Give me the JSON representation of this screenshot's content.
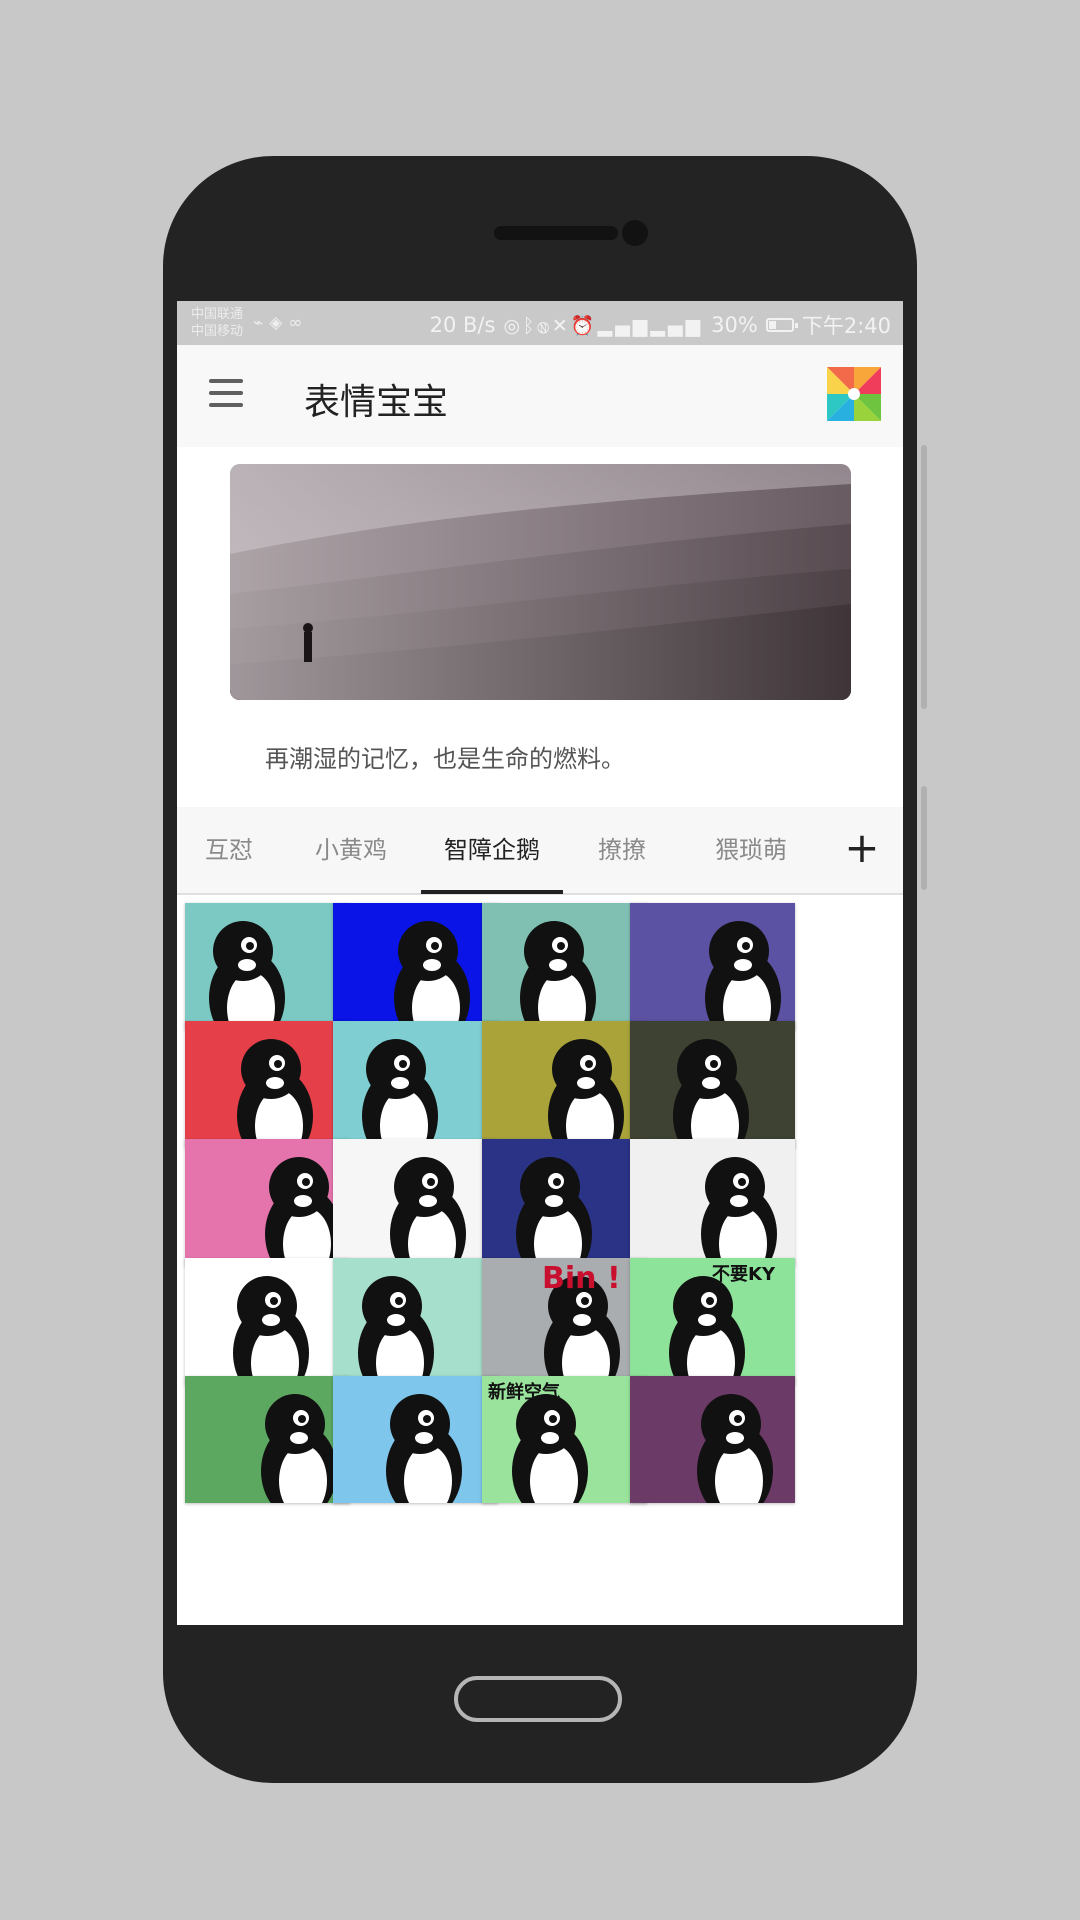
{
  "status_bar": {
    "carrier_1": "中国联通",
    "carrier_2": "中国移动",
    "left_icons": [
      "usb-icon",
      "vpn-icon",
      "sync-icon"
    ],
    "net_speed": "20 B/s",
    "right_icons": [
      "hotspot-icon",
      "bluetooth-icon",
      "nfc-icon",
      "mute-icon",
      "alarm-icon",
      "signal-4g-icon",
      "signal-2g-icon"
    ],
    "battery": "30%",
    "battery_level": 0.3,
    "time": "下午2:40"
  },
  "app_bar": {
    "title": "表情宝宝",
    "menu_icon": "hamburger-menu-icon",
    "logo_icon": "pinwheel-icon"
  },
  "banner": {
    "quote": "再潮湿的记忆，也是生命的燃料。"
  },
  "tabs": {
    "items": [
      "互怼",
      "小黄鸡",
      "智障企鹅",
      "撩撩",
      "猥琐萌"
    ],
    "active_index": 2,
    "add_label": "+"
  },
  "stickers": {
    "items": [
      {
        "bg": "#7cc9c4",
        "text": ""
      },
      {
        "bg": "#0a14e6",
        "text": ""
      },
      {
        "bg": "#7fc0b2",
        "text": ""
      },
      {
        "bg": "#5c52a3",
        "text": ""
      },
      {
        "bg": "#e5404a",
        "text": ""
      },
      {
        "bg": "#7fcfd2",
        "text": ""
      },
      {
        "bg": "#a9a33a",
        "text": ""
      },
      {
        "bg": "#3d4233",
        "text": ""
      },
      {
        "bg": "#e574ad",
        "text": ""
      },
      {
        "bg": "#f6f6f6",
        "text": ""
      },
      {
        "bg": "#2b3386",
        "text": ""
      },
      {
        "bg": "#f0f0f0",
        "text": ""
      },
      {
        "bg": "#ffffff",
        "text": ""
      },
      {
        "bg": "#a6dfcb",
        "text": ""
      },
      {
        "bg": "#a9adb0",
        "text": "Bin !"
      },
      {
        "bg": "#8ee39a",
        "text": "不要KY"
      },
      {
        "bg": "#5ca860",
        "text": ""
      },
      {
        "bg": "#7fc6ec",
        "text": ""
      },
      {
        "bg": "#99e39c",
        "text": "新鲜空气"
      },
      {
        "bg": "#6c3a66",
        "text": ""
      }
    ]
  },
  "device": {
    "frame_color": "#232323"
  }
}
